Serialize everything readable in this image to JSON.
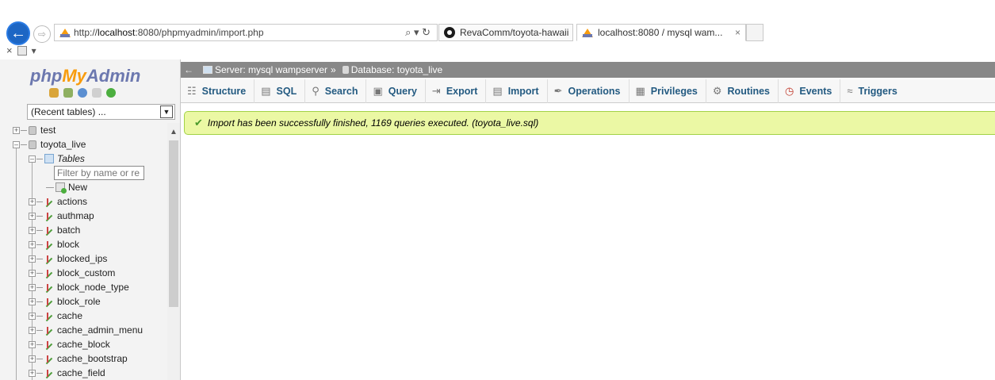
{
  "browser": {
    "url_prefix": "http://",
    "url_host": "localhost",
    "url_rest": ":8080/phpmyadmin/import.php",
    "address_tools": "⌕ ▾ ↻",
    "back_glyph": "←",
    "forward_glyph": "⇨",
    "tabs": [
      {
        "label": "RevaComm/toyota-hawaii",
        "icon": "github-icon"
      },
      {
        "label": "localhost:8080 / mysql wam...",
        "icon": "pma-favicon",
        "close": "×"
      }
    ],
    "command_close": "×",
    "command_menu": "▾"
  },
  "nav": {
    "logo_php": "php",
    "logo_my": "My",
    "logo_admin": "Admin",
    "recent_tables": "(Recent tables) ...",
    "filter_placeholder": "Filter by name or re",
    "databases": [
      {
        "name": "test"
      },
      {
        "name": "toyota_live"
      }
    ],
    "tables_label": "Tables",
    "new_label": "New",
    "tables": [
      "actions",
      "authmap",
      "batch",
      "block",
      "blocked_ips",
      "block_custom",
      "block_node_type",
      "block_role",
      "cache",
      "cache_admin_menu",
      "cache_block",
      "cache_bootstrap",
      "cache_field"
    ]
  },
  "breadcrumb": {
    "server": "Server: mysql wampserver",
    "separator": "»",
    "database": "Database: toyota_live"
  },
  "menu": [
    {
      "label": "Structure",
      "icon": "structure-icon"
    },
    {
      "label": "SQL",
      "icon": "sql-icon"
    },
    {
      "label": "Search",
      "icon": "search-icon"
    },
    {
      "label": "Query",
      "icon": "query-icon"
    },
    {
      "label": "Export",
      "icon": "export-icon"
    },
    {
      "label": "Import",
      "icon": "import-icon"
    },
    {
      "label": "Operations",
      "icon": "wrench-icon"
    },
    {
      "label": "Privileges",
      "icon": "privileges-icon"
    },
    {
      "label": "Routines",
      "icon": "routines-icon"
    },
    {
      "label": "Events",
      "icon": "clock-icon"
    },
    {
      "label": "Triggers",
      "icon": "triggers-icon"
    }
  ],
  "notice": {
    "message": "Import has been successfully finished, 1169 queries executed. (toyota_live.sql)"
  },
  "colors": {
    "notice_bg": "#ebf8a4",
    "menu_text": "#235a81",
    "breadcrumb_bg": "#888888"
  }
}
